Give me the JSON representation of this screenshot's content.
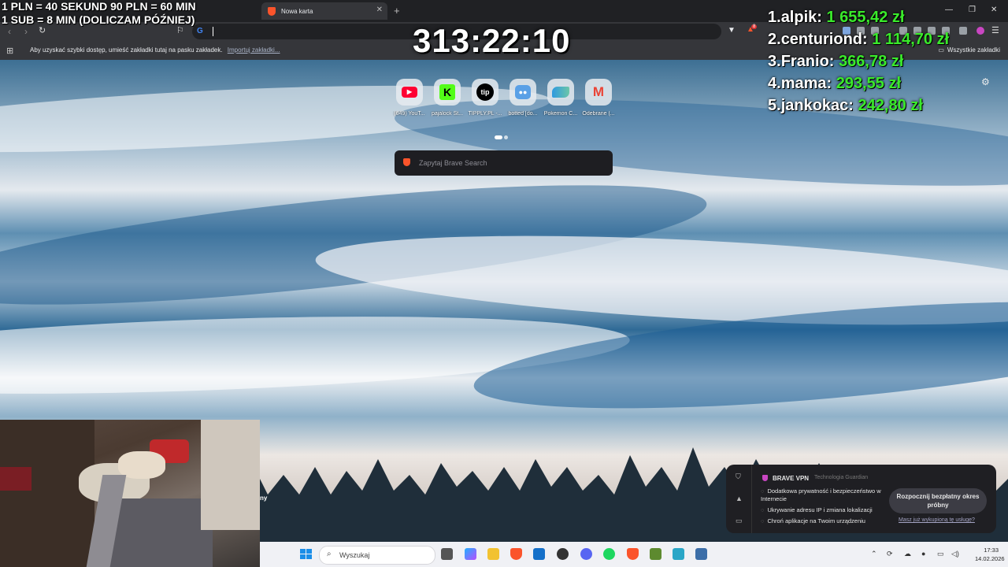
{
  "overlay": {
    "rule_line1": "1 PLN = 40 SEKUND 90 PLN = 60 MIN",
    "rule_line2": "1 SUB = 8 MIN (DOLICZAM PÓŹNIEJ)",
    "timer": "313:22:10"
  },
  "leaderboard": [
    {
      "rank": "1.",
      "name": "alpik:",
      "amount": "1 655,42 zł"
    },
    {
      "rank": "2.",
      "name": "centuriond:",
      "amount": "1 114,70 zł"
    },
    {
      "rank": "3.",
      "name": "Franio:",
      "amount": "366,78 zł"
    },
    {
      "rank": "4.",
      "name": "mama:",
      "amount": "293,55 zł"
    },
    {
      "rank": "5.",
      "name": "jankokac:",
      "amount": "242,80 zł"
    }
  ],
  "browser": {
    "active_tab": "Nowa karta",
    "bookmarks_hint": "Aby uzyskać szybki dostęp, umieść zakładki tutaj na pasku zakładek.",
    "bookmarks_import": "Importuj zakładki...",
    "all_bookmarks": "Wszystkie zakładki",
    "extension_badge": "8"
  },
  "newtab": {
    "shortcuts": [
      {
        "label": "(649) YouT...",
        "icon": "youtube-icon",
        "color": "#ff0033"
      },
      {
        "label": "pajalock St...",
        "icon": "kick-icon",
        "color": "#53fc18"
      },
      {
        "label": "TIPPLY.PL -...",
        "icon": "tipply-icon",
        "color": "#000000"
      },
      {
        "label": "botted [do...",
        "icon": "robot-icon",
        "color": "#5aa0e6"
      },
      {
        "label": "Pokemon C...",
        "icon": "pokemon-icon",
        "color": "#2e9ae0"
      },
      {
        "label": "Odebrane (...",
        "icon": "gmail-icon",
        "color": "#ea4335"
      }
    ],
    "search_placeholder": "Zapytaj Brave Search"
  },
  "vpn_popup": {
    "title": "BRAVE VPN",
    "subtitle": "Technologia  Guardian",
    "features": [
      "Dodatkowa prywatność i bezpieczeństwo w Internecie",
      "Ukrywanie adresu IP i zmiana lokalizacji",
      "Chroń aplikacje na Twoim urządzeniu"
    ],
    "cta": "Rozpocznij bezpłatny okres próbny",
    "link": "Masz już wykupioną tę usługę?"
  },
  "side_text": "ny",
  "taskbar": {
    "search_placeholder": "Wyszukaj",
    "time": "17:33",
    "date": "14.02.2026"
  }
}
